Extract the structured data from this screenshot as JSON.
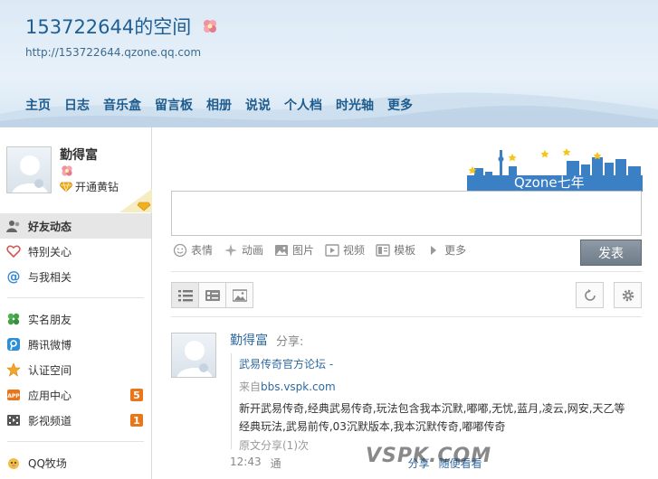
{
  "header": {
    "title": "153722644的空间",
    "url": "http://153722644.qzone.qq.com",
    "nav": [
      "主页",
      "日志",
      "音乐盒",
      "留言板",
      "相册",
      "说说",
      "个人档",
      "时光轴",
      "更多"
    ]
  },
  "profile": {
    "name": "勤得富",
    "vip_label": "开通黄钻"
  },
  "sidebar": {
    "group1": [
      {
        "label": "好友动态",
        "icon": "friends-icon"
      },
      {
        "label": "特别关心",
        "icon": "heart-icon"
      },
      {
        "label": "与我相关",
        "icon": "at-icon"
      }
    ],
    "group2": [
      {
        "label": "实名朋友",
        "icon": "clover-icon"
      },
      {
        "label": "腾讯微博",
        "icon": "weibo-icon"
      },
      {
        "label": "认证空间",
        "icon": "star-icon"
      },
      {
        "label": "应用中心",
        "icon": "app-icon",
        "badge": "5"
      },
      {
        "label": "影视频道",
        "icon": "film-icon",
        "badge": "1"
      }
    ],
    "group3": [
      {
        "label": "QQ牧场",
        "icon": "farm-icon"
      }
    ]
  },
  "banner": {
    "text": "Qzone七年"
  },
  "composer": {
    "tools": [
      {
        "label": "表情",
        "icon": "smile-icon"
      },
      {
        "label": "动画",
        "icon": "sparkle-icon"
      },
      {
        "label": "图片",
        "icon": "picture-icon"
      },
      {
        "label": "视频",
        "icon": "video-icon"
      },
      {
        "label": "模板",
        "icon": "template-icon"
      },
      {
        "label": "更多",
        "icon": "triangle-right-icon"
      }
    ],
    "publish_label": "发表"
  },
  "feed": {
    "name": "勤得富",
    "action": "分享:",
    "share_title": "武易传奇官方论坛 -",
    "from_prefix": "来自",
    "from_site": "bbs.vspk.com",
    "body": "新开武易传奇,经典武易传奇,玩法包含我本沉默,嘟嘟,无忧,蓝月,凌云,网安,天乙等经典玩法,武易前传,03沉默版本,我本沉默传奇,嘟嘟传奇",
    "original_share": "原文分享(1)次",
    "time": "12:43",
    "via": "通",
    "action_share": "分享",
    "action_browse": "随便看看"
  },
  "watermark": "VSPK.COM",
  "colors": {
    "accent": "#1f5e93",
    "badge": "#e8771c",
    "publish": "#7a8794"
  }
}
